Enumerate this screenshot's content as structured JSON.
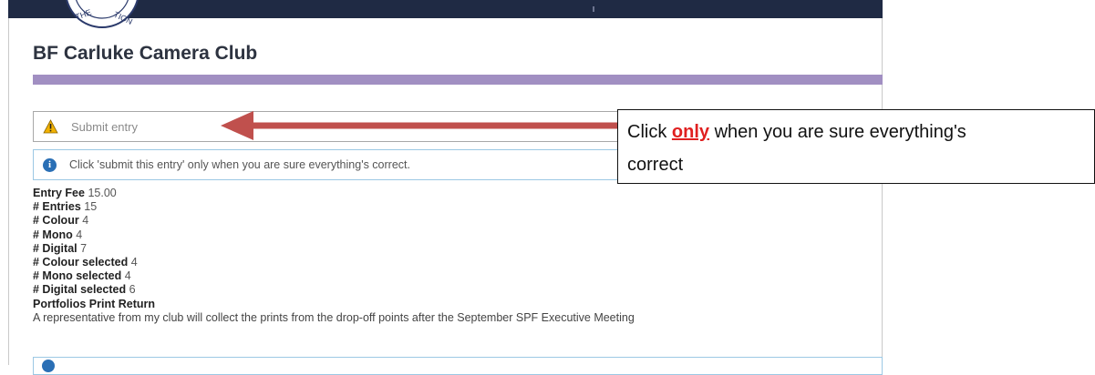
{
  "header": {
    "logo_text": "THE ... TION",
    "title": "BF Carluke Camera Club"
  },
  "submit": {
    "label": "Submit entry",
    "icon": "warning-triangle-icon"
  },
  "info": {
    "icon": "info-circle-icon",
    "text": "Click 'submit this entry' only when you are sure everything's correct."
  },
  "details": [
    {
      "label": "Entry Fee",
      "value": "15.00"
    },
    {
      "label": "# Entries",
      "value": "15"
    },
    {
      "label": "# Colour",
      "value": "4"
    },
    {
      "label": "# Mono",
      "value": "4"
    },
    {
      "label": "# Digital",
      "value": "7"
    },
    {
      "label": "# Colour selected",
      "value": "4"
    },
    {
      "label": "# Mono selected",
      "value": "4"
    },
    {
      "label": "# Digital selected",
      "value": "6"
    }
  ],
  "portfolio": {
    "title": "Portfolios Print Return",
    "text": "A representative from my club will collect the prints from the drop-off points after the September SPF Executive Meeting"
  },
  "callout": {
    "prefix": "Click ",
    "emphasis": "only",
    "line1_rest": " when you are sure everything's",
    "line2": "correct"
  },
  "colors": {
    "header_band": "#1f2a44",
    "accent_bar": "#a18fc2",
    "info_border": "#9cc8e4",
    "arrow": "#c0504d",
    "emphasis": "#e02020"
  }
}
